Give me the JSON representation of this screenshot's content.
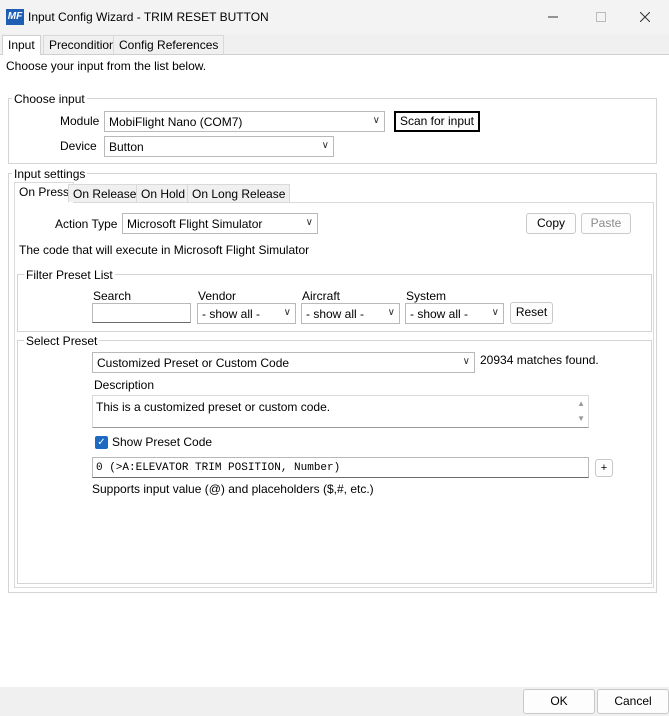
{
  "window": {
    "title": "Input Config Wizard - TRIM RESET BUTTON",
    "icon_text": "MF"
  },
  "tabs": [
    "Input",
    "Precondition",
    "Config References"
  ],
  "intro_text": "Choose your input from the list below.",
  "choose_input": {
    "title": "Choose input",
    "module_label": "Module",
    "module_value": "MobiFlight Nano (COM7)",
    "scan_button": "Scan for input",
    "device_label": "Device",
    "device_value": "Button"
  },
  "input_settings": {
    "title": "Input settings",
    "tabs": [
      "On Press",
      "On Release",
      "On Hold",
      "On Long Release"
    ],
    "action_type_label": "Action Type",
    "action_type_value": "Microsoft Flight Simulator",
    "copy_button": "Copy",
    "paste_button": "Paste",
    "code_desc": "The code that will execute in Microsoft Flight Simulator"
  },
  "filter": {
    "title": "Filter Preset List",
    "search_label": "Search",
    "search_value": "",
    "vendor_label": "Vendor",
    "vendor_value": "- show all -",
    "aircraft_label": "Aircraft",
    "aircraft_value": "- show all -",
    "system_label": "System",
    "system_value": "- show all -",
    "reset_button": "Reset"
  },
  "select_preset": {
    "title": "Select Preset",
    "preset_value": "Customized Preset or Custom Code",
    "matches": "20934 matches found.",
    "description_label": "Description",
    "description_value": "This is a customized preset or custom code.",
    "show_code_label": "Show Preset Code",
    "show_code_checked": true,
    "code_value": "0 (>A:ELEVATOR TRIM POSITION, Number)",
    "plus_button": "+",
    "supports_text": "Supports input value (@) and placeholders ($,#, etc.)"
  },
  "footer": {
    "ok_button": "OK",
    "cancel_button": "Cancel"
  },
  "colors": {
    "accent": "#1f6ac1",
    "icon_bg": "#1e5fb3"
  }
}
